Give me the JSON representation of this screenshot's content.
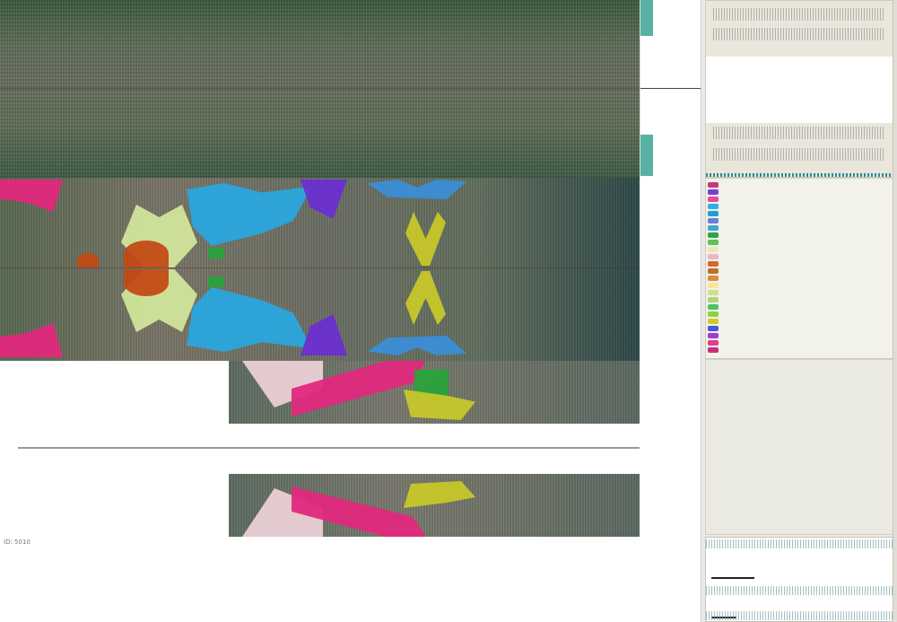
{
  "viewer": {
    "status_text": "ID: 5010"
  },
  "legend": {
    "items": [
      {
        "color": "#c23b7a"
      },
      {
        "color": "#7a3fd1"
      },
      {
        "color": "#e24ba0"
      },
      {
        "color": "#2fb0e4"
      },
      {
        "color": "#1e9fd6"
      },
      {
        "color": "#6e7dd8"
      },
      {
        "color": "#3da8d0"
      },
      {
        "color": "#2ca54a"
      },
      {
        "color": "#5ec15b"
      },
      {
        "color": "#e9e7bd"
      },
      {
        "color": "#e6b9c6"
      },
      {
        "color": "#d46a2a"
      },
      {
        "color": "#b9722e"
      },
      {
        "color": "#e08a3b"
      },
      {
        "color": "#f3e59b"
      },
      {
        "color": "#cfe08a"
      },
      {
        "color": "#b2d37a"
      },
      {
        "color": "#4fbf62"
      },
      {
        "color": "#8ad33a"
      },
      {
        "color": "#d1c92a"
      },
      {
        "color": "#4b55d8"
      },
      {
        "color": "#9a3fd2"
      },
      {
        "color": "#e03c90"
      },
      {
        "color": "#c8307a"
      }
    ]
  },
  "colors": {
    "magenta": "#e2287d",
    "cyan": "#2aa7dd",
    "purple": "#6a2fd0",
    "orange": "#c24a16",
    "lime": "#d1e59a",
    "yellow": "#c6c72a",
    "green": "#2aa23b",
    "pink_light": "#ead0d5"
  }
}
